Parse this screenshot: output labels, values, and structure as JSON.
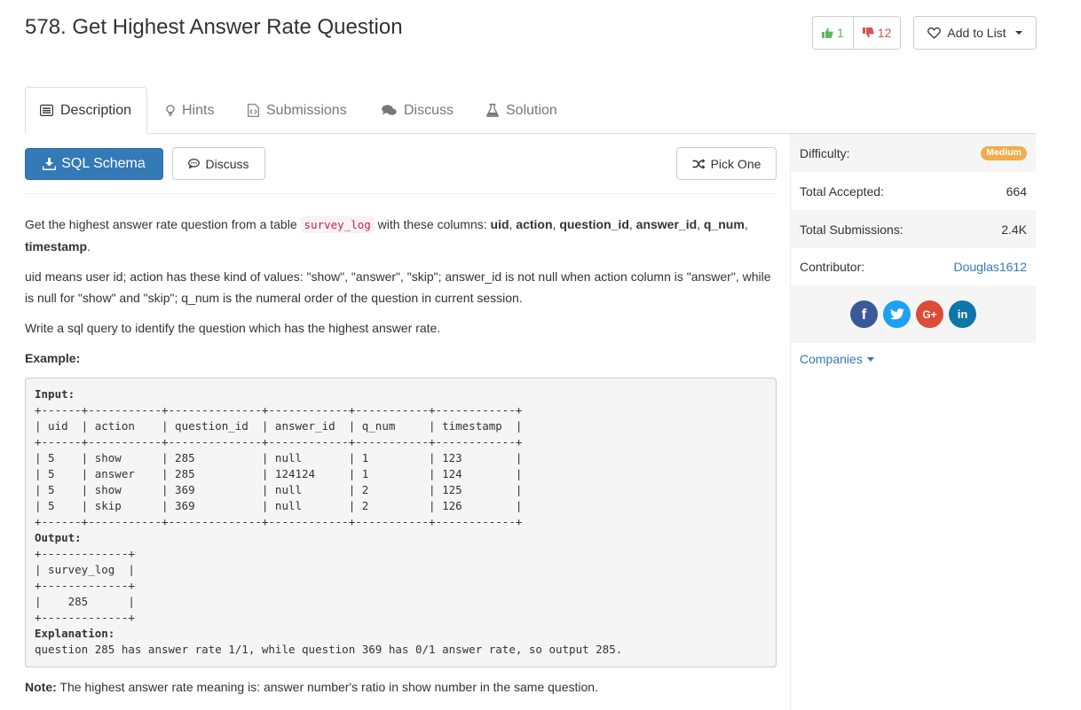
{
  "header": {
    "title": "578. Get Highest Answer Rate Question",
    "upvotes": "1",
    "downvotes": "12",
    "add_to_list": "Add to List"
  },
  "tabs": [
    {
      "label": "Description",
      "icon": "list-alt-icon",
      "active": true
    },
    {
      "label": "Hints",
      "icon": "lightbulb-icon"
    },
    {
      "label": "Submissions",
      "icon": "code-file-icon"
    },
    {
      "label": "Discuss",
      "icon": "comments-icon"
    },
    {
      "label": "Solution",
      "icon": "flask-icon"
    }
  ],
  "actions": {
    "schema_label": "SQL Schema",
    "discuss_label": "Discuss",
    "pick_one_label": "Pick One"
  },
  "description": {
    "intro_prefix": "Get the highest answer rate question from a table ",
    "table_name": "survey_log",
    "intro_mid": " with these columns: ",
    "columns": [
      "uid",
      "action",
      "question_id",
      "answer_id",
      "q_num",
      "timestamp"
    ],
    "para2": "uid means user id; action has these kind of values: \"show\", \"answer\", \"skip\"; answer_id is not null when action column is \"answer\", while is null for \"show\" and \"skip\"; q_num is the numeral order of the question in current session.",
    "para3": "Write a sql query to identify the question which has the highest answer rate.",
    "example_label": "Example:",
    "input_label": "Input:",
    "input_table": "+------+-----------+--------------+------------+-----------+------------+\n| uid  | action    | question_id  | answer_id  | q_num     | timestamp  |\n+------+-----------+--------------+------------+-----------+------------+\n| 5    | show      | 285          | null       | 1         | 123        |\n| 5    | answer    | 285          | 124124     | 1         | 124        |\n| 5    | show      | 369          | null       | 2         | 125        |\n| 5    | skip      | 369          | null       | 2         | 126        |\n+------+-----------+--------------+------------+-----------+------------+",
    "output_label": "Output:",
    "output_table": "+-------------+\n| survey_log  |\n+-------------+\n|    285      |\n+-------------+",
    "explanation_label": "Explanation:",
    "explanation": "question 285 has answer rate 1/1, while question 369 has 0/1 answer rate, so output 285.",
    "note_label": "Note:",
    "note": " The highest answer rate meaning is: answer number's ratio in show number in the same question."
  },
  "sidebar": {
    "difficulty_label": "Difficulty:",
    "difficulty_value": "Medium",
    "accepted_label": "Total Accepted:",
    "accepted_value": "664",
    "submissions_label": "Total Submissions:",
    "submissions_value": "2.4K",
    "contributor_label": "Contributor:",
    "contributor_value": "Douglas1612",
    "social": [
      {
        "name": "facebook",
        "glyph": "f",
        "color": "#3b5998"
      },
      {
        "name": "twitter",
        "glyph": "t",
        "color": "#1da1f2"
      },
      {
        "name": "google-plus",
        "glyph": "G+",
        "color": "#dd4b39"
      },
      {
        "name": "linkedin",
        "glyph": "in",
        "color": "#0e76a8"
      }
    ],
    "companies_label": "Companies"
  },
  "colors": {
    "primary": "#337ab7",
    "upvote": "#5cb85c",
    "downvote": "#d9534f",
    "badge_medium": "#f0ad4e",
    "inline_code": "#c7254e"
  }
}
